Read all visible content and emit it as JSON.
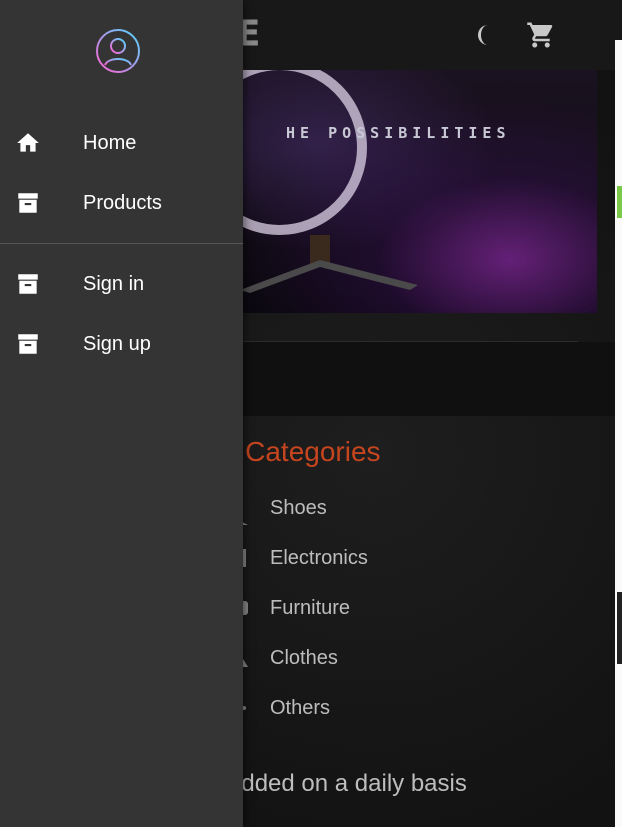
{
  "header": {
    "logo_text": "ORE",
    "theme_icon": "moon-icon",
    "cart_icon": "cart-icon"
  },
  "hero": {
    "tagline": "HE POSSIBILITIES"
  },
  "categories": {
    "title": "uct Categories",
    "items": [
      {
        "label": "Shoes"
      },
      {
        "label": "Electronics"
      },
      {
        "label": "Furniture"
      },
      {
        "label": "Clothes"
      },
      {
        "label": "Others"
      }
    ]
  },
  "footer_text": "re added on a daily basis",
  "drawer": {
    "avatar_icon": "user-circle-icon",
    "nav": [
      {
        "label": "Home",
        "icon": "home-icon"
      },
      {
        "label": "Products",
        "icon": "archive-icon"
      }
    ],
    "account": [
      {
        "label": "Sign in",
        "icon": "archive-icon"
      },
      {
        "label": "Sign up",
        "icon": "archive-icon"
      }
    ]
  },
  "colors": {
    "accent": "#c5451f",
    "drawer_bg": "#343434",
    "page_bg": "#141414",
    "avatar_gradient": [
      "#ff5fd1",
      "#4fd6ff"
    ]
  }
}
